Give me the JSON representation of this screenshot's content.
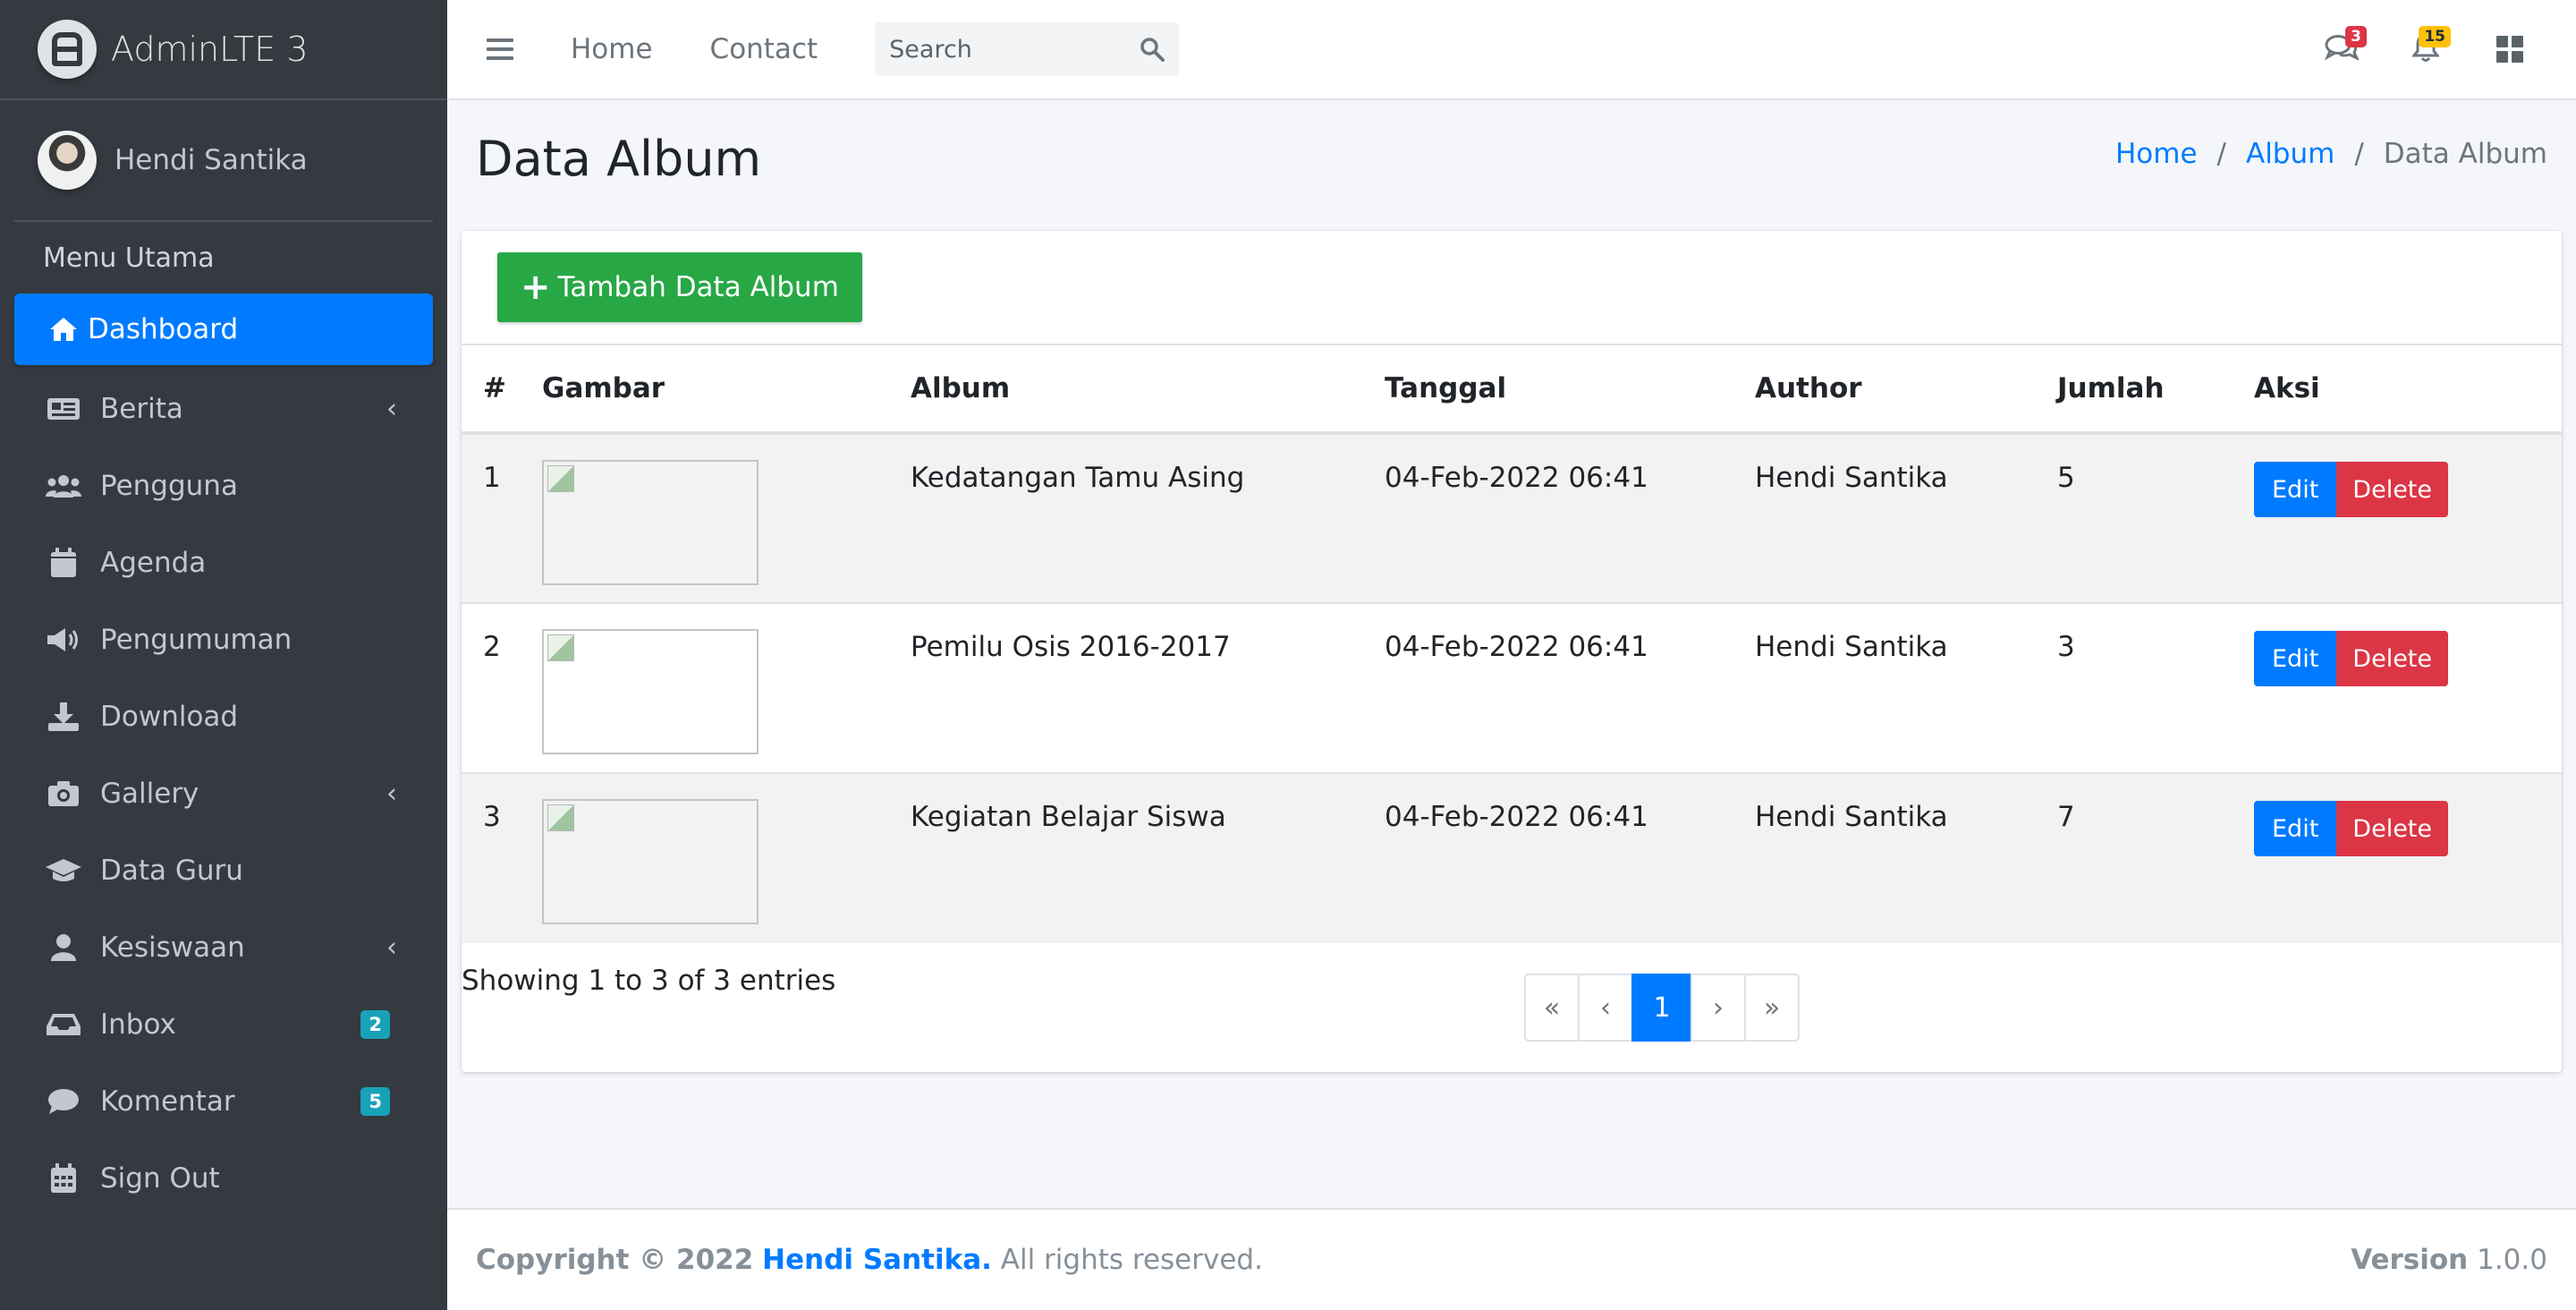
{
  "brand": {
    "name": "AdminLTE 3"
  },
  "user": {
    "name": "Hendi Santika"
  },
  "sidebar": {
    "header": "Menu Utama",
    "items": [
      {
        "label": "Dashboard",
        "icon": "home-icon",
        "active": true
      },
      {
        "label": "Berita",
        "icon": "newspaper-icon",
        "has_submenu": true
      },
      {
        "label": "Pengguna",
        "icon": "users-icon"
      },
      {
        "label": "Agenda",
        "icon": "calendar-icon"
      },
      {
        "label": "Pengumuman",
        "icon": "megaphone-icon"
      },
      {
        "label": "Download",
        "icon": "download-icon"
      },
      {
        "label": "Gallery",
        "icon": "camera-icon",
        "has_submenu": true
      },
      {
        "label": "Data Guru",
        "icon": "graduation-cap-icon"
      },
      {
        "label": "Kesiswaan",
        "icon": "user-icon",
        "has_submenu": true
      },
      {
        "label": "Inbox",
        "icon": "inbox-icon",
        "badge": "2"
      },
      {
        "label": "Komentar",
        "icon": "comment-icon",
        "badge": "5"
      },
      {
        "label": "Sign Out",
        "icon": "calendar-grid-icon"
      }
    ]
  },
  "navbar": {
    "links": [
      "Home",
      "Contact"
    ],
    "search_placeholder": "Search",
    "messages_badge": "3",
    "notifications_badge": "15"
  },
  "page": {
    "title": "Data Album",
    "breadcrumb": [
      "Home",
      "Album",
      "Data Album"
    ]
  },
  "toolbar": {
    "add_label": "Tambah Data Album"
  },
  "table": {
    "headers": [
      "#",
      "Gambar",
      "Album",
      "Tanggal",
      "Author",
      "Jumlah",
      "Aksi"
    ],
    "rows": [
      {
        "no": "1",
        "album": "Kedatangan Tamu Asing",
        "tanggal": "04-Feb-2022 06:41",
        "author": "Hendi Santika",
        "jumlah": "5"
      },
      {
        "no": "2",
        "album": "Pemilu Osis 2016-2017",
        "tanggal": "04-Feb-2022 06:41",
        "author": "Hendi Santika",
        "jumlah": "3"
      },
      {
        "no": "3",
        "album": "Kegiatan Belajar Siswa",
        "tanggal": "04-Feb-2022 06:41",
        "author": "Hendi Santika",
        "jumlah": "7"
      }
    ],
    "edit_label": "Edit",
    "delete_label": "Delete",
    "info": "Showing 1 to 3 of 3 entries",
    "pagination": [
      "«",
      "‹",
      "1",
      "›",
      "»"
    ]
  },
  "footer": {
    "copyright": "Copyright © 2022",
    "author": "Hendi Santika.",
    "rights": "All rights reserved.",
    "version_label": "Version",
    "version": "1.0.0"
  },
  "colors": {
    "primary": "#007bff",
    "success": "#28a745",
    "danger": "#dc3545",
    "warning": "#ffc107",
    "info": "#17a2b8",
    "sidebar": "#343a40"
  }
}
